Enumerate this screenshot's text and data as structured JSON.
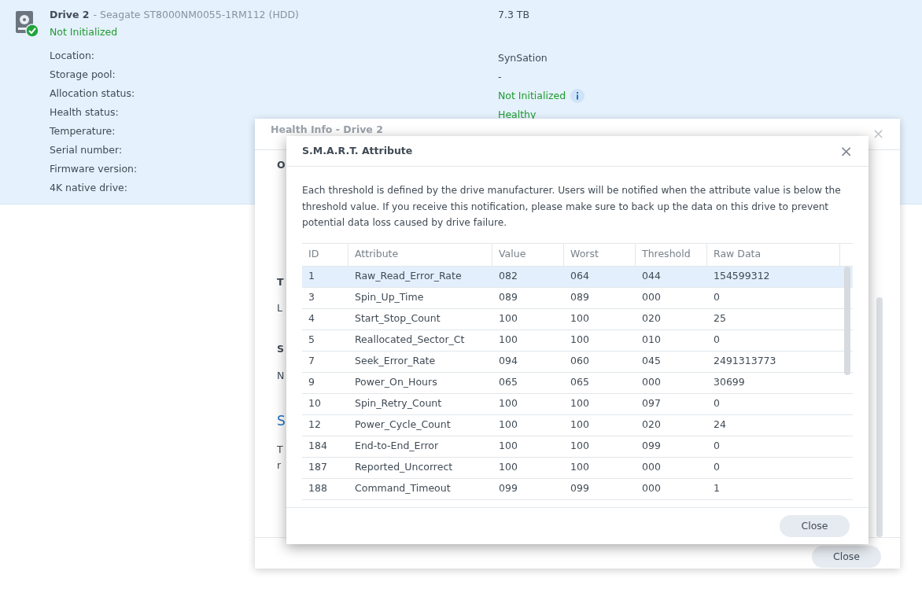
{
  "drive": {
    "name": "Drive 2",
    "model": "- Seagate ST8000NM0055-1RM112 (HDD)",
    "status": "Not Initialized",
    "capacity": "7.3 TB",
    "properties": [
      {
        "label": "Location:",
        "value": "SynSation",
        "kind": "plain"
      },
      {
        "label": "Storage pool:",
        "value": "-",
        "kind": "plain"
      },
      {
        "label": "Allocation status:",
        "value": "Not Initialized",
        "kind": "status_info"
      },
      {
        "label": "Health status:",
        "value": "Healthy",
        "kind": "status"
      },
      {
        "label": "Temperature:"
      },
      {
        "label": "Serial number:"
      },
      {
        "label": "Firmware version:"
      },
      {
        "label": "4K native drive:"
      }
    ]
  },
  "health_dialog": {
    "title": "Health Info - Drive 2",
    "close_glyph": "×",
    "fragments": [
      {
        "text": "O",
        "kind": "tab"
      },
      {
        "text": "T",
        "kind": "heading"
      },
      {
        "text": "L",
        "kind": "text"
      },
      {
        "text": "S",
        "kind": "heading"
      },
      {
        "text": "N",
        "kind": "text"
      },
      {
        "text": "S",
        "kind": "link"
      },
      {
        "text": "T",
        "kind": "text"
      },
      {
        "text": "r",
        "kind": "text"
      }
    ],
    "footer_button": "Close"
  },
  "smart_dialog": {
    "title": "S.M.A.R.T. Attribute",
    "close_glyph": "×",
    "description": "Each threshold is defined by the drive manufacturer. Users will be notified when the attribute value is below the threshold value. If you receive this notification, please make sure to back up the data on this drive to prevent potential data loss caused by drive failure.",
    "table": {
      "columns": [
        "ID",
        "Attribute",
        "Value",
        "Worst",
        "Threshold",
        "Raw Data"
      ],
      "rows": [
        {
          "cells": [
            "1",
            "Raw_Read_Error_Rate",
            "082",
            "064",
            "044",
            "154599312"
          ],
          "selected": true
        },
        {
          "cells": [
            "3",
            "Spin_Up_Time",
            "089",
            "089",
            "000",
            "0"
          ],
          "selected": false
        },
        {
          "cells": [
            "4",
            "Start_Stop_Count",
            "100",
            "100",
            "020",
            "25"
          ],
          "selected": false
        },
        {
          "cells": [
            "5",
            "Reallocated_Sector_Ct",
            "100",
            "100",
            "010",
            "0"
          ],
          "selected": false
        },
        {
          "cells": [
            "7",
            "Seek_Error_Rate",
            "094",
            "060",
            "045",
            "2491313773"
          ],
          "selected": false
        },
        {
          "cells": [
            "9",
            "Power_On_Hours",
            "065",
            "065",
            "000",
            "30699"
          ],
          "selected": false
        },
        {
          "cells": [
            "10",
            "Spin_Retry_Count",
            "100",
            "100",
            "097",
            "0"
          ],
          "selected": false
        },
        {
          "cells": [
            "12",
            "Power_Cycle_Count",
            "100",
            "100",
            "020",
            "24"
          ],
          "selected": false
        },
        {
          "cells": [
            "184",
            "End-to-End_Error",
            "100",
            "100",
            "099",
            "0"
          ],
          "selected": false
        },
        {
          "cells": [
            "187",
            "Reported_Uncorrect",
            "100",
            "100",
            "000",
            "0"
          ],
          "selected": false
        },
        {
          "cells": [
            "188",
            "Command_Timeout",
            "099",
            "099",
            "000",
            "1"
          ],
          "selected": false
        }
      ]
    },
    "footer_button": "Close"
  }
}
